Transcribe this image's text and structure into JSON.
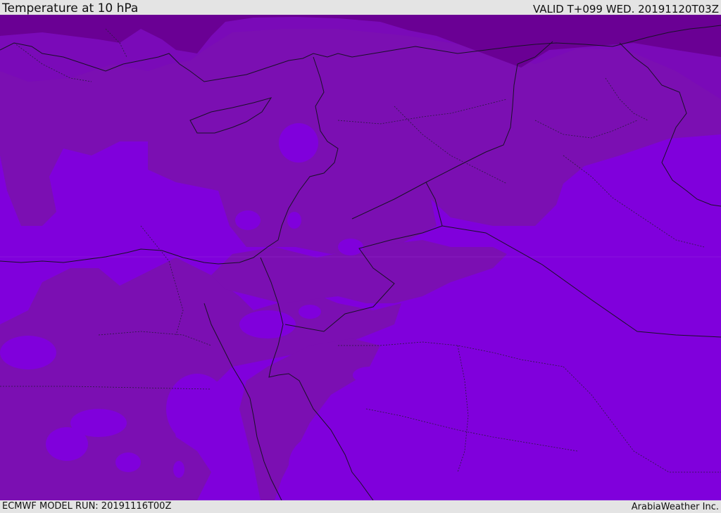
{
  "header": {
    "title": "Temperature at 10 hPa",
    "valid_time": "VALID T+099 WED. 20191120T03Z"
  },
  "footer": {
    "model_run": "ECMWF MODEL RUN: 20191116T00Z",
    "credit": "ArabiaWeather Inc."
  },
  "map": {
    "variable": "temperature",
    "pressure_level": "10 hPa",
    "fill_levels": {
      "coldest": "#6a0094",
      "cold": "#7b0fb2",
      "mid": "#7a0ab8",
      "warm": "#8000dc"
    },
    "border_color": "#1a1028",
    "internal_boundary_color": "#2a1a40"
  }
}
